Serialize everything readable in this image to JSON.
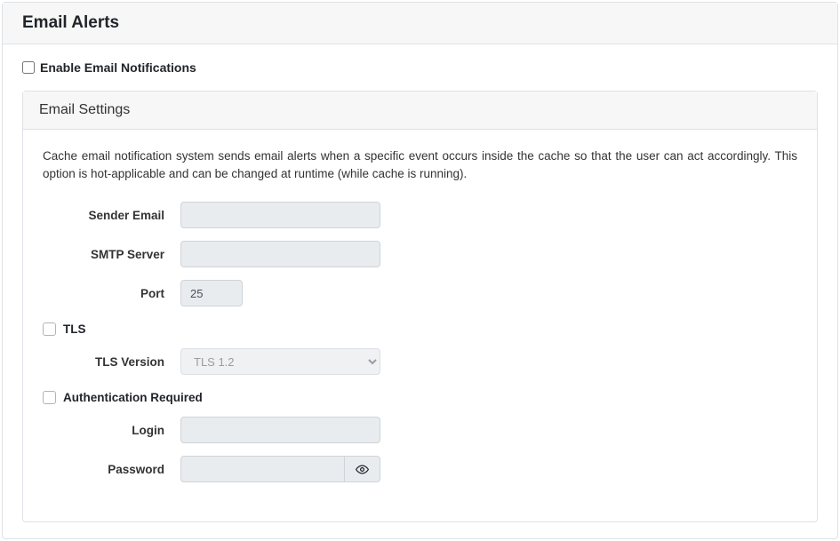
{
  "header": {
    "title": "Email Alerts"
  },
  "enable": {
    "label": "Enable Email Notifications",
    "checked": false
  },
  "settings": {
    "title": "Email Settings",
    "description": "Cache email notification system sends email alerts when a specific event occurs inside the cache so that the user can act accordingly. This option is hot-applicable and can be changed at runtime (while cache is running).",
    "sender_email": {
      "label": "Sender Email",
      "value": ""
    },
    "smtp_server": {
      "label": "SMTP Server",
      "value": ""
    },
    "port": {
      "label": "Port",
      "value": "25"
    },
    "tls": {
      "label": "TLS",
      "checked": false
    },
    "tls_version": {
      "label": "TLS Version",
      "selected": "TLS 1.2",
      "options": [
        "TLS 1.2"
      ]
    },
    "auth_required": {
      "label": "Authentication Required",
      "checked": false
    },
    "login": {
      "label": "Login",
      "value": ""
    },
    "password": {
      "label": "Password",
      "value": ""
    }
  }
}
